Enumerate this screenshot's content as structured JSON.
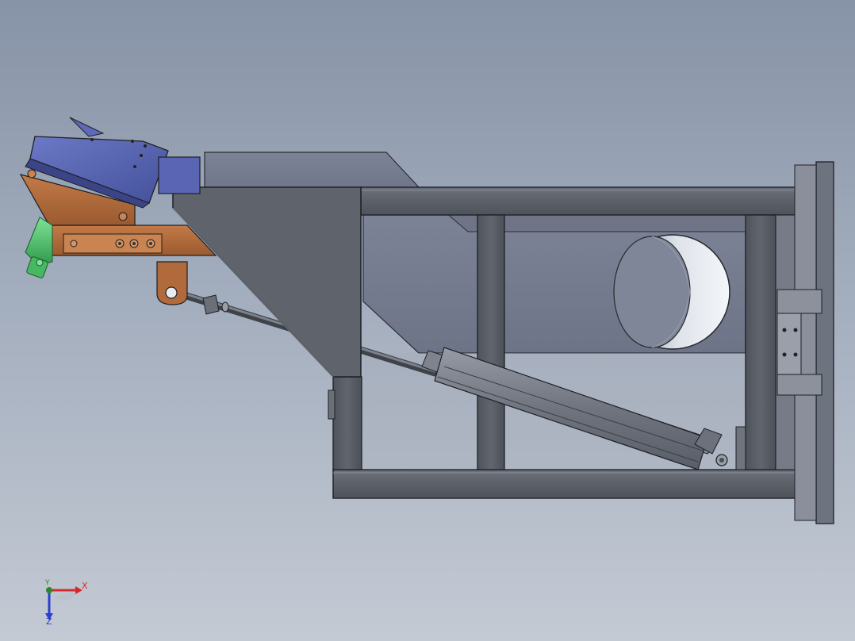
{
  "viewport": {
    "background_top": "#8793a6",
    "background_bottom": "#c4cad4"
  },
  "model": {
    "frame_color": "#5e636c",
    "panel_color": "#7b8193",
    "gusset_color": "#5a5e66",
    "bracket_color": "#b06a3c",
    "motor_color": "#4f5aa8",
    "motor_light_color": "#6b79c6",
    "nozzle_color": "#4cc36a",
    "cylinder_color": "#7a7f8a",
    "outline_color": "#1e2024"
  },
  "triad": {
    "x_label": "X",
    "y_label": "Y",
    "z_label": "Z",
    "x_color": "#d42a2a",
    "y_color": "#2a8a2a",
    "z_color": "#2a3fd0"
  }
}
